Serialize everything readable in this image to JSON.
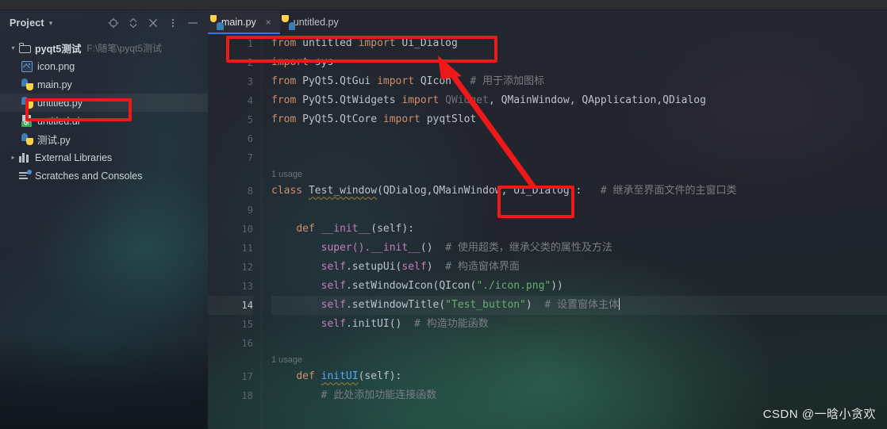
{
  "window": {
    "title": ""
  },
  "sidebar": {
    "title": "Project",
    "caret": "▾",
    "tools": [
      {
        "name": "locate-icon",
        "label": "Select Opened File"
      },
      {
        "name": "collapse-all-icon",
        "label": "Collapse All"
      },
      {
        "name": "close-icon",
        "label": "Hide"
      },
      {
        "name": "more-options-icon",
        "label": "Options"
      },
      {
        "name": "minimize-icon",
        "label": "Minimize"
      }
    ],
    "tree": [
      {
        "label": "pyqt5测试",
        "path": "F:\\随笔\\pyqt5测试",
        "icon": "folder-icon",
        "arrow": "▾",
        "depth": 0,
        "bold": true,
        "selected": false
      },
      {
        "label": "icon.png",
        "path": "",
        "icon": "image-file-icon",
        "arrow": "",
        "depth": 1,
        "bold": false,
        "selected": false
      },
      {
        "label": "main.py",
        "path": "",
        "icon": "python-file-icon",
        "arrow": "",
        "depth": 1,
        "bold": false,
        "selected": false
      },
      {
        "label": "untitled.py",
        "path": "",
        "icon": "python-file-icon",
        "arrow": "",
        "depth": 1,
        "bold": false,
        "selected": true
      },
      {
        "label": "untitled.ui",
        "path": "",
        "icon": "qt-ui-file-icon",
        "arrow": "",
        "depth": 1,
        "bold": false,
        "selected": false
      },
      {
        "label": "测试.py",
        "path": "",
        "icon": "python-file-icon",
        "arrow": "",
        "depth": 1,
        "bold": false,
        "selected": false
      },
      {
        "label": "External Libraries",
        "path": "",
        "icon": "library-icon",
        "arrow": "▸",
        "depth": 0,
        "bold": false,
        "selected": false
      },
      {
        "label": "Scratches and Consoles",
        "path": "",
        "icon": "scratches-icon",
        "arrow": "",
        "depth": 0,
        "bold": false,
        "selected": false
      }
    ]
  },
  "editor": {
    "tabs": [
      {
        "label": "main.py",
        "icon": "python-file-icon",
        "active": true,
        "closable": true,
        "close_glyph": "×"
      },
      {
        "label": "untitled.py",
        "icon": "python-file-icon",
        "active": false,
        "closable": false,
        "close_glyph": ""
      }
    ],
    "current_line": 14,
    "line_numbers": [
      "1",
      "2",
      "3",
      "4",
      "5",
      "6",
      "7",
      "8",
      "9",
      "10",
      "11",
      "12",
      "13",
      "14",
      "15",
      "16",
      "17",
      "18"
    ],
    "inlay_hints": [
      {
        "before_line": 8,
        "text": "1 usage"
      },
      {
        "before_line": 17,
        "text": "1 usage"
      }
    ],
    "lines": [
      {
        "n": 1,
        "text": "from untitled import Ui_Dialog"
      },
      {
        "n": 2,
        "text": "import sys"
      },
      {
        "n": 3,
        "text": "from PyQt5.QtGui import QIcon   # 用于添加图标"
      },
      {
        "n": 4,
        "text": "from PyQt5.QtWidgets import QWidget, QMainWindow, QApplication,QDialog"
      },
      {
        "n": 5,
        "text": "from PyQt5.QtCore import pyqtSlot"
      },
      {
        "n": 6,
        "text": ""
      },
      {
        "n": 7,
        "text": ""
      },
      {
        "n": 8,
        "text": "class Test_window(QDialog,QMainWindow, Ui_Dialog):   # 继承至界面文件的主窗口类"
      },
      {
        "n": 9,
        "text": ""
      },
      {
        "n": 10,
        "text": "    def __init__(self):"
      },
      {
        "n": 11,
        "text": "        super().__init__()  # 使用超类，继承父类的属性及方法"
      },
      {
        "n": 12,
        "text": "        self.setupUi(self)  # 构造窗体界面"
      },
      {
        "n": 13,
        "text": "        self.setWindowIcon(QIcon(\"./icon.png\"))"
      },
      {
        "n": 14,
        "text": "        self.setWindowTitle(\"Test_button\")  # 设置窗体主体"
      },
      {
        "n": 15,
        "text": "        self.initUI()  # 构造功能函数"
      },
      {
        "n": 16,
        "text": ""
      },
      {
        "n": 17,
        "text": "    def initUI(self):"
      },
      {
        "n": 18,
        "text": "        # 此处添加功能连接函数"
      }
    ],
    "tokens": {
      "l1": {
        "kw_from": "from",
        "mod": "untitled",
        "kw_import": "import",
        "name": "Ui_Dialog"
      },
      "l2": {
        "kw_import": "import",
        "mod": "sys"
      },
      "l3": {
        "kw_from": "from",
        "mod": "PyQt5.QtGui",
        "kw_import": "import",
        "name": "QIcon",
        "comment": "# 用于添加图标"
      },
      "l4": {
        "kw_from": "from",
        "mod": "PyQt5.QtWidgets",
        "kw_import": "import",
        "unused": "QWidget",
        "rest": ", QMainWindow, QApplication,QDialog"
      },
      "l5": {
        "kw_from": "from",
        "mod": "PyQt5.QtCore",
        "kw_import": "import",
        "name": "pyqtSlot"
      },
      "l8": {
        "kw_class": "class",
        "name": "Test_window",
        "bases": "(QDialog,QMainWindow, Ui_Dialog):",
        "comment": "# 继承至界面文件的主窗口类"
      },
      "l10": {
        "kw_def": "def",
        "name": "__init__",
        "args": "(self):"
      },
      "l11": {
        "call": "super()",
        "dot_name": ".__init__",
        "args": "()",
        "comment": "# 使用超类，继承父类的属性及方法"
      },
      "l12": {
        "self": "self",
        "method": ".setupUi(",
        "arg": "self",
        "close": ")",
        "comment": "# 构造窗体界面"
      },
      "l13": {
        "self": "self",
        "method": ".setWindowIcon(QIcon(",
        "str": "\"./icon.png\"",
        "close": "))"
      },
      "l14": {
        "self": "self",
        "method": ".setWindowTitle(",
        "str": "\"Test_button\"",
        "close": ")",
        "comment": "# 设置窗体主体"
      },
      "l15": {
        "self": "self",
        "method": ".initUI()",
        "comment": "# 构造功能函数"
      },
      "l17": {
        "kw_def": "def",
        "name": "initUI",
        "args": "(self):"
      },
      "l18": {
        "comment": "# 此处添加功能连接函数"
      }
    }
  },
  "annotations": {
    "boxes": [
      {
        "name": "line1-import-highlight",
        "color": "#f01919"
      },
      {
        "name": "ui-dialog-base-highlight",
        "color": "#f01919"
      },
      {
        "name": "sidebar-untitled-py-highlight",
        "color": "#f01919"
      }
    ],
    "arrow": {
      "name": "link-arrow",
      "color": "#f01919",
      "from": "Ui_Dialog base class",
      "to": "line 1 import statement"
    }
  },
  "watermark": {
    "text": "CSDN @一晗小贪欢"
  }
}
